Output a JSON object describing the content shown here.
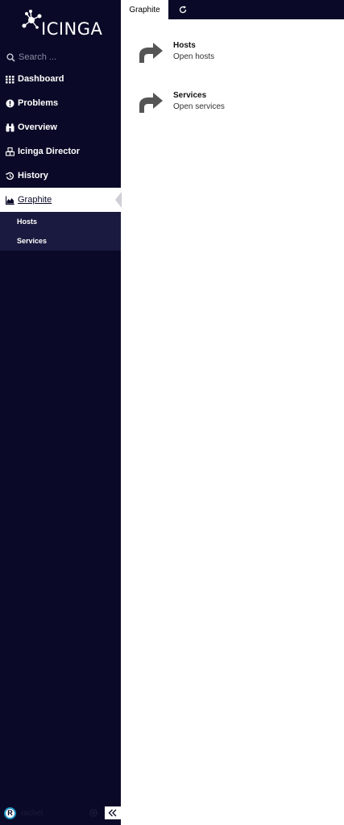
{
  "app": {
    "logo_text": "ICINGA"
  },
  "search": {
    "placeholder": "Search ..."
  },
  "nav": {
    "items": [
      {
        "label": "Dashboard",
        "icon": "grid-icon"
      },
      {
        "label": "Problems",
        "icon": "alert-circle-icon"
      },
      {
        "label": "Overview",
        "icon": "binoculars-icon"
      },
      {
        "label": "Icinga Director",
        "icon": "cubes-icon"
      },
      {
        "label": "History",
        "icon": "history-icon"
      },
      {
        "label": "Graphite",
        "icon": "area-chart-icon",
        "active": true
      }
    ],
    "sub_items": [
      {
        "label": "Hosts"
      },
      {
        "label": "Services"
      }
    ]
  },
  "user": {
    "initial": "R",
    "name": "rachel"
  },
  "tabs": {
    "active_label": "Graphite"
  },
  "content": {
    "entries": [
      {
        "title": "Hosts",
        "subtitle": "Open hosts"
      },
      {
        "title": "Services",
        "subtitle": "Open services"
      }
    ]
  },
  "colors": {
    "sidebar": "#0a0a28",
    "subnav": "#1a1a40",
    "accent": "#1e90c0"
  }
}
